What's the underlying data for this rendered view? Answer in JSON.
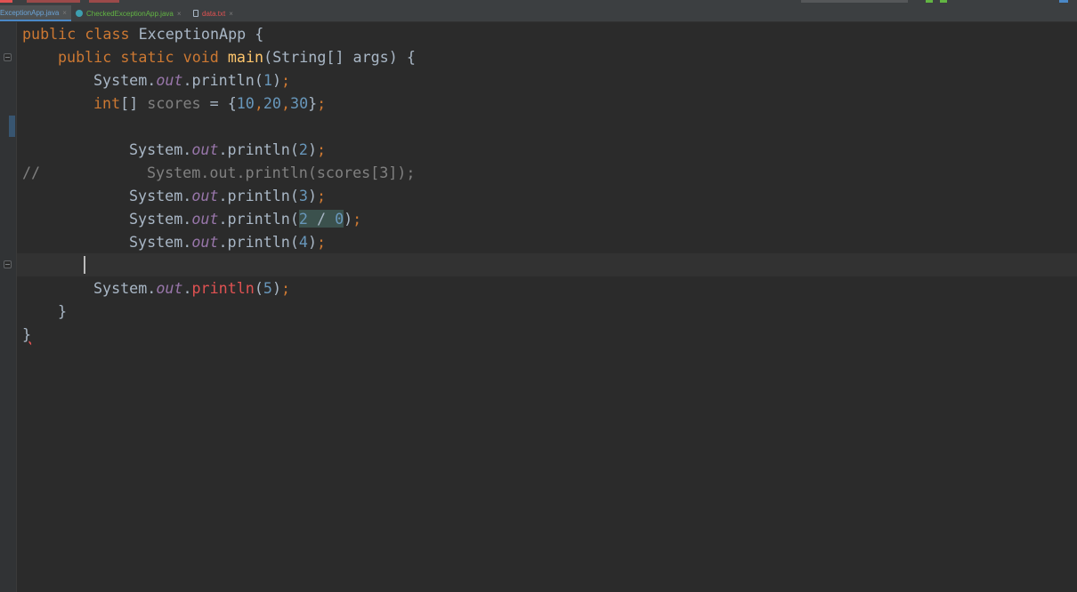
{
  "tabs": [
    {
      "label": "ExceptionApp.java",
      "active": true,
      "color": "#6ba3d6"
    },
    {
      "label": "CheckedExceptionApp.java",
      "active": false,
      "color": "#62b543",
      "icon": "java-class-icon"
    },
    {
      "label": "data.txt",
      "active": false,
      "color": "#e05252",
      "icon": "txt-file-icon"
    }
  ],
  "tab_close_glyph": "×",
  "colors": {
    "keyword": "#cc7832",
    "method": "#ffc66d",
    "number": "#6897bb",
    "field": "#9876aa",
    "comment": "#808080",
    "error": "#e05252",
    "text": "#a9b7c6"
  },
  "code": {
    "l1": {
      "kw": "public class ",
      "name": "ExceptionApp",
      "brace": " {"
    },
    "l2": {
      "kw": "public static void ",
      "fn": "main",
      "params": "(String[] args) {"
    },
    "l3": {
      "obj": "System.",
      "field": "out",
      "call": ".println(",
      "arg": "1",
      "end": ")",
      "semi": ";"
    },
    "l4": {
      "type": "int",
      "decl": "[] ",
      "var": "scores",
      "assign": " = {",
      "n1": "10",
      "c1": ",",
      "n2": "20",
      "c2": ",",
      "n3": "30",
      "close": "}",
      "semi": ";"
    },
    "l5": {
      "obj": "System.",
      "field": "out",
      "call": ".println(",
      "arg": "2",
      "end": ")",
      "semi": ";"
    },
    "l6": {
      "comment_mark": "//",
      "text": "System.out.println(scores[3]);"
    },
    "l7": {
      "obj": "System.",
      "field": "out",
      "call": ".println(",
      "arg": "3",
      "end": ")",
      "semi": ";"
    },
    "l8": {
      "obj": "System.",
      "field": "out",
      "call": ".println(",
      "n1": "2",
      "op": " / ",
      "n2": "0",
      "end": ")",
      "semi": ";"
    },
    "l9": {
      "obj": "System.",
      "field": "out",
      "call": ".println(",
      "arg": "4",
      "end": ")",
      "semi": ";"
    },
    "l11": {
      "obj": "System.",
      "field": "out",
      "dot": ".",
      "call": "println",
      "open": "(",
      "arg": "5",
      "end": ")",
      "semi": ";"
    },
    "l12": {
      "brace": "}"
    },
    "l13": {
      "brace": "}"
    }
  }
}
